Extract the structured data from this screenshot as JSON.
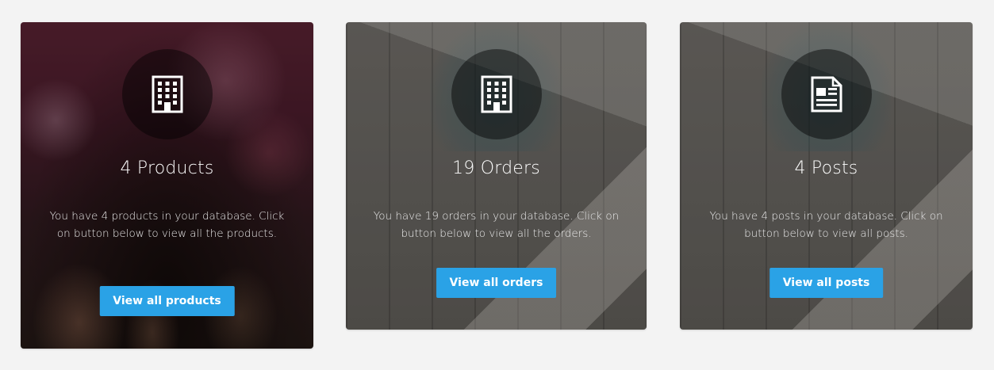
{
  "cards": [
    {
      "icon": "building-icon",
      "title": "4 Products",
      "description": "You have 4 products in your database. Click on button below to view all the products.",
      "button": "View all products"
    },
    {
      "icon": "building-icon",
      "title": "19 Orders",
      "description": "You have 19 orders in your database. Click on button below to view all the orders.",
      "button": "View all orders"
    },
    {
      "icon": "newspaper-icon",
      "title": "4 Posts",
      "description": "You have 4 posts in your database. Click on button below to view all posts.",
      "button": "View all posts"
    }
  ],
  "colors": {
    "button": "#2aa2e6",
    "page_background": "#f3f3f3"
  }
}
